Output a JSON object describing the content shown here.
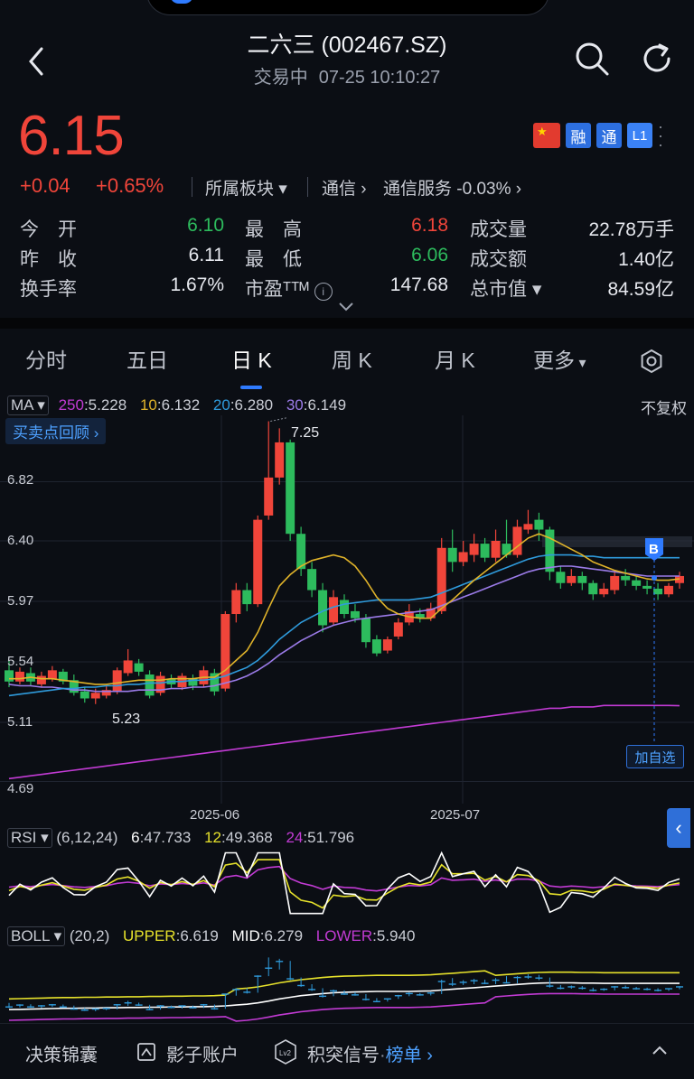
{
  "header": {
    "title": "二六三 (002467.SZ)",
    "status": "交易中",
    "datetime": "07-25 10:10:27"
  },
  "quote": {
    "price": "6.15",
    "change": "+0.04",
    "change_pct": "+0.65%",
    "sector_label": "所属板块",
    "sector1": "通信",
    "sector2": "通信服务",
    "sector2_change": "-0.03%",
    "badges": [
      "融",
      "通",
      "L1"
    ]
  },
  "stats": {
    "open_label": "今　开",
    "open": "6.10",
    "prev_label": "昨　收",
    "prev": "6.11",
    "turnover_label": "换手率",
    "turnover": "1.67%",
    "high_label": "最　高",
    "high": "6.18",
    "low_label": "最　低",
    "low": "6.06",
    "pe_label": "市盈ᵀᵀᴹ",
    "pe": "147.68",
    "volume_label": "成交量",
    "volume": "22.78万手",
    "amount_label": "成交额",
    "amount": "1.40亿",
    "mktcap_label": "总市值",
    "mktcap": "84.59亿"
  },
  "tabs": [
    {
      "label": "分时"
    },
    {
      "label": "五日"
    },
    {
      "label": "日 K"
    },
    {
      "label": "周 K"
    },
    {
      "label": "月 K"
    },
    {
      "label": "更多"
    }
  ],
  "ma": {
    "label": "MA",
    "items": [
      {
        "k": "250",
        "v": "5.228",
        "color": "#c23bd4"
      },
      {
        "k": "10",
        "v": "6.132",
        "color": "#e0b32a"
      },
      {
        "k": "20",
        "v": "6.280",
        "color": "#2f9bdc"
      },
      {
        "k": "30",
        "v": "6.149",
        "color": "#9b7be8"
      }
    ],
    "adjust": "不复权",
    "review_label": "买卖点回顾"
  },
  "chart_data": {
    "type": "candlestick",
    "y_ticks": [
      "6.82",
      "6.40",
      "5.97",
      "5.54",
      "5.11",
      "4.69"
    ],
    "x_ticks": [
      "2025-06",
      "2025-07"
    ],
    "max_label": "7.25",
    "min_label": "5.23",
    "buy_marker": "B",
    "candles": [
      [
        5.48,
        5.4,
        5.55,
        5.36
      ],
      [
        5.4,
        5.47,
        5.5,
        5.38
      ],
      [
        5.46,
        5.4,
        5.5,
        5.37
      ],
      [
        5.38,
        5.44,
        5.47,
        5.36
      ],
      [
        5.42,
        5.48,
        5.51,
        5.4
      ],
      [
        5.47,
        5.4,
        5.49,
        5.38
      ],
      [
        5.41,
        5.32,
        5.45,
        5.3
      ],
      [
        5.33,
        5.28,
        5.36,
        5.25
      ],
      [
        5.28,
        5.32,
        5.35,
        5.24
      ],
      [
        5.3,
        5.34,
        5.37,
        5.28
      ],
      [
        5.33,
        5.48,
        5.5,
        5.31
      ],
      [
        5.46,
        5.55,
        5.63,
        5.44
      ],
      [
        5.53,
        5.47,
        5.56,
        5.44
      ],
      [
        5.45,
        5.3,
        5.48,
        5.28
      ],
      [
        5.32,
        5.44,
        5.47,
        5.3
      ],
      [
        5.42,
        5.38,
        5.45,
        5.35
      ],
      [
        5.36,
        5.44,
        5.46,
        5.34
      ],
      [
        5.42,
        5.37,
        5.45,
        5.34
      ],
      [
        5.38,
        5.48,
        5.51,
        5.36
      ],
      [
        5.46,
        5.33,
        5.49,
        5.3
      ],
      [
        5.35,
        5.88,
        5.9,
        5.33
      ],
      [
        5.88,
        6.05,
        6.1,
        5.82
      ],
      [
        6.05,
        5.95,
        6.1,
        5.9
      ],
      [
        5.95,
        6.55,
        6.58,
        5.93
      ],
      [
        6.58,
        6.85,
        7.25,
        6.55
      ],
      [
        6.85,
        7.1,
        7.2,
        6.8
      ],
      [
        7.1,
        6.45,
        7.12,
        6.4
      ],
      [
        6.45,
        6.2,
        6.5,
        6.15
      ],
      [
        6.2,
        6.05,
        6.25,
        6.0
      ],
      [
        6.05,
        5.8,
        6.1,
        5.75
      ],
      [
        5.82,
        6.0,
        6.05,
        5.8
      ],
      [
        5.98,
        5.88,
        6.02,
        5.85
      ],
      [
        5.9,
        5.85,
        5.95,
        5.82
      ],
      [
        5.85,
        5.68,
        5.88,
        5.64
      ],
      [
        5.7,
        5.6,
        5.73,
        5.58
      ],
      [
        5.62,
        5.7,
        5.72,
        5.6
      ],
      [
        5.72,
        5.82,
        5.85,
        5.7
      ],
      [
        5.82,
        5.9,
        5.95,
        5.8
      ],
      [
        5.88,
        5.85,
        5.92,
        5.82
      ],
      [
        5.85,
        5.92,
        5.96,
        5.83
      ],
      [
        5.9,
        6.35,
        6.42,
        5.88
      ],
      [
        6.35,
        6.25,
        6.48,
        6.18
      ],
      [
        6.25,
        6.32,
        6.4,
        6.22
      ],
      [
        6.3,
        6.38,
        6.45,
        6.25
      ],
      [
        6.38,
        6.28,
        6.42,
        6.25
      ],
      [
        6.28,
        6.4,
        6.48,
        6.25
      ],
      [
        6.38,
        6.3,
        6.55,
        6.28
      ],
      [
        6.3,
        6.5,
        6.55,
        6.28
      ],
      [
        6.48,
        6.52,
        6.62,
        6.45
      ],
      [
        6.55,
        6.48,
        6.6,
        6.4
      ],
      [
        6.48,
        6.18,
        6.5,
        6.12
      ],
      [
        6.18,
        6.1,
        6.22,
        6.06
      ],
      [
        6.1,
        6.15,
        6.2,
        6.08
      ],
      [
        6.15,
        6.1,
        6.18,
        6.05
      ],
      [
        6.1,
        6.02,
        6.12,
        5.98
      ],
      [
        6.02,
        6.06,
        6.1,
        6.0
      ],
      [
        6.05,
        6.15,
        6.18,
        6.02
      ],
      [
        6.15,
        6.12,
        6.2,
        6.08
      ],
      [
        6.12,
        6.08,
        6.15,
        6.05
      ],
      [
        6.08,
        6.06,
        6.12,
        6.02
      ],
      [
        6.06,
        6.02,
        6.1,
        5.98
      ],
      [
        6.02,
        6.08,
        6.1,
        6.0
      ],
      [
        6.1,
        6.15,
        6.18,
        6.06
      ]
    ],
    "ma10": [
      5.42,
      5.42,
      5.43,
      5.42,
      5.42,
      5.41,
      5.4,
      5.39,
      5.38,
      5.38,
      5.39,
      5.4,
      5.41,
      5.41,
      5.41,
      5.42,
      5.42,
      5.42,
      5.43,
      5.43,
      5.48,
      5.55,
      5.62,
      5.75,
      5.92,
      6.08,
      6.16,
      6.22,
      6.26,
      6.28,
      6.3,
      6.28,
      6.22,
      6.12,
      6.0,
      5.92,
      5.88,
      5.86,
      5.85,
      5.85,
      5.92,
      5.98,
      6.05,
      6.12,
      6.18,
      6.24,
      6.3,
      6.36,
      6.42,
      6.45,
      6.42,
      6.38,
      6.34,
      6.3,
      6.25,
      6.22,
      6.19,
      6.17,
      6.15,
      6.13,
      6.12,
      6.12,
      6.13
    ],
    "ma20": [
      5.3,
      5.31,
      5.32,
      5.33,
      5.34,
      5.35,
      5.35,
      5.36,
      5.36,
      5.37,
      5.37,
      5.38,
      5.38,
      5.39,
      5.39,
      5.4,
      5.4,
      5.41,
      5.41,
      5.42,
      5.44,
      5.47,
      5.5,
      5.55,
      5.62,
      5.7,
      5.76,
      5.82,
      5.86,
      5.9,
      5.93,
      5.95,
      5.96,
      5.97,
      5.98,
      5.98,
      5.98,
      5.98,
      5.99,
      6.0,
      6.03,
      6.06,
      6.09,
      6.12,
      6.15,
      6.18,
      6.21,
      6.24,
      6.27,
      6.29,
      6.3,
      6.3,
      6.3,
      6.29,
      6.29,
      6.28,
      6.28,
      6.28,
      6.28,
      6.28,
      6.28,
      6.28,
      6.28
    ],
    "ma30": [
      5.38,
      5.37,
      5.37,
      5.36,
      5.36,
      5.35,
      5.34,
      5.34,
      5.33,
      5.33,
      5.33,
      5.33,
      5.34,
      5.34,
      5.34,
      5.35,
      5.35,
      5.36,
      5.36,
      5.37,
      5.39,
      5.41,
      5.44,
      5.48,
      5.53,
      5.59,
      5.64,
      5.69,
      5.73,
      5.77,
      5.8,
      5.82,
      5.84,
      5.85,
      5.86,
      5.87,
      5.88,
      5.89,
      5.9,
      5.91,
      5.94,
      5.97,
      6.0,
      6.03,
      6.06,
      6.09,
      6.12,
      6.15,
      6.18,
      6.2,
      6.21,
      6.22,
      6.22,
      6.21,
      6.2,
      6.19,
      6.18,
      6.17,
      6.16,
      6.15,
      6.15,
      6.15,
      6.15
    ],
    "ma250": [
      4.71,
      4.72,
      4.73,
      4.74,
      4.75,
      4.76,
      4.77,
      4.78,
      4.79,
      4.8,
      4.81,
      4.82,
      4.83,
      4.84,
      4.85,
      4.86,
      4.87,
      4.88,
      4.89,
      4.9,
      4.91,
      4.92,
      4.93,
      4.94,
      4.95,
      4.96,
      4.97,
      4.98,
      4.99,
      5.0,
      5.01,
      5.02,
      5.03,
      5.04,
      5.05,
      5.06,
      5.07,
      5.08,
      5.09,
      5.1,
      5.11,
      5.12,
      5.13,
      5.14,
      5.15,
      5.16,
      5.17,
      5.18,
      5.19,
      5.2,
      5.21,
      5.21,
      5.22,
      5.22,
      5.22,
      5.23,
      5.23,
      5.23,
      5.23,
      5.23,
      5.23,
      5.23,
      5.228
    ]
  },
  "rsi": {
    "label": "RSI",
    "params": "(6,12,24)",
    "items": [
      {
        "k": "6",
        "v": "47.733",
        "color": "#ffffff"
      },
      {
        "k": "12",
        "v": "49.368",
        "color": "#e6e12b"
      },
      {
        "k": "24",
        "v": "51.796",
        "color": "#c23bd4"
      }
    ]
  },
  "boll": {
    "label": "BOLL",
    "params": "(20,2)",
    "items": [
      {
        "k": "UPPER",
        "v": "6.619",
        "color": "#e6e12b"
      },
      {
        "k": "MID",
        "v": "6.279",
        "color": "#ffffff"
      },
      {
        "k": "LOWER",
        "v": "5.940",
        "color": "#c23bd4"
      }
    ]
  },
  "add_fav": "加自选",
  "bottom": {
    "item1": "决策锦囊",
    "item2": "影子账户",
    "item3": "积突信号",
    "item3_sep": "·",
    "item4": "榜单"
  },
  "colors": {
    "up": "#f0453a",
    "down": "#2dbb5d",
    "accent": "#2f7bff"
  }
}
